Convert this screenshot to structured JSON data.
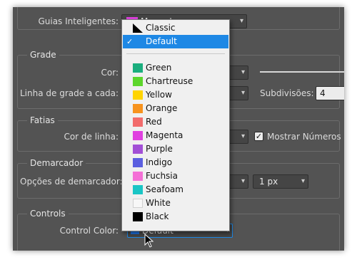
{
  "guides": {
    "label": "Guias Inteligentes:",
    "value": "Magenta",
    "swatch": "#e040e0"
  },
  "grid": {
    "legend": "Grade",
    "color_label": "Cor:",
    "every_label": "Linha de grade a cada:",
    "subdivisions_label": "Subdivisões:",
    "subdivisions_value": "4"
  },
  "slices": {
    "legend": "Fatias",
    "line_color_label": "Cor de linha:",
    "show_numbers_label": "Mostrar Números d",
    "show_numbers_checked": "✓"
  },
  "marker": {
    "legend": "Demarcador",
    "options_label": "Opções de demarcador:",
    "width_value": "1 px"
  },
  "controls": {
    "legend": "Controls",
    "color_label": "Control Color:",
    "value": "Default",
    "swatch": "#1e6fd9"
  },
  "dropdown": {
    "top_items": [
      {
        "label": "Classic",
        "icon": "classic-triangle-icon"
      },
      {
        "label": "Default",
        "selected": true,
        "check": "✓"
      }
    ],
    "color_items": [
      {
        "label": "Green",
        "color": "#1bae7e"
      },
      {
        "label": "Chartreuse",
        "color": "#5dd62c"
      },
      {
        "label": "Yellow",
        "color": "#ffd400"
      },
      {
        "label": "Orange",
        "color": "#f7931e"
      },
      {
        "label": "Red",
        "color": "#f26c6c"
      },
      {
        "label": "Magenta",
        "color": "#e040e0"
      },
      {
        "label": "Purple",
        "color": "#a24fd6"
      },
      {
        "label": "Indigo",
        "color": "#5b5fe0"
      },
      {
        "label": "Fuchsia",
        "color": "#f470d6"
      },
      {
        "label": "Seafoam",
        "color": "#19c5c5"
      },
      {
        "label": "White",
        "color": "#f7f7f7"
      },
      {
        "label": "Black",
        "color": "#000000"
      }
    ]
  }
}
